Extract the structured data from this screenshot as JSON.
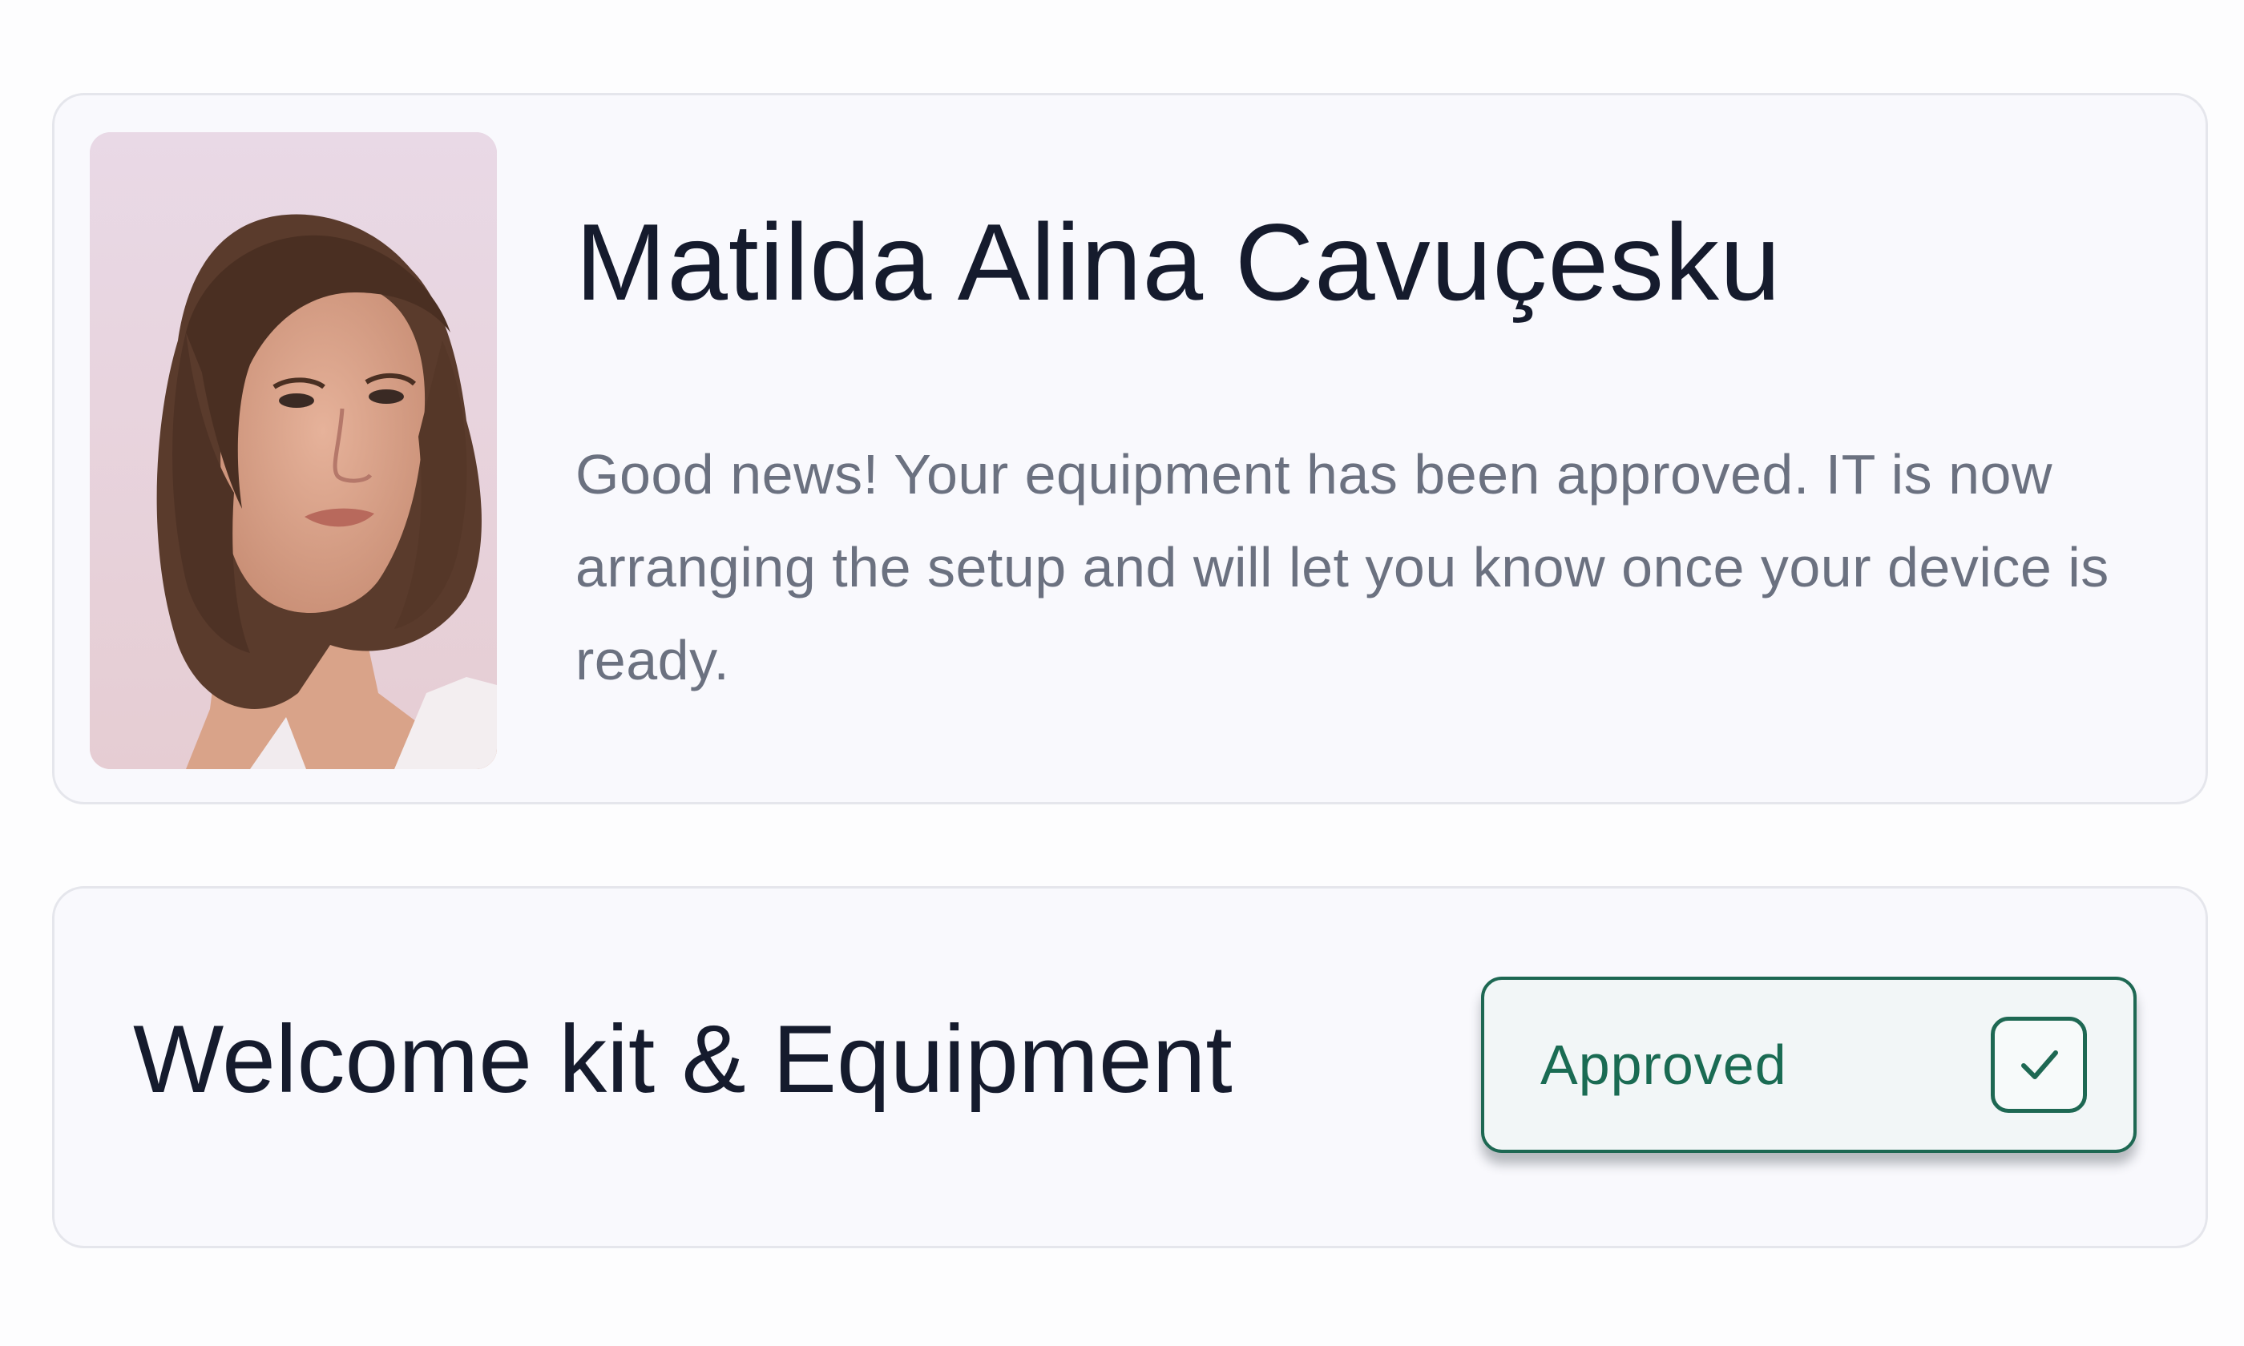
{
  "profile": {
    "name": "Matilda Alina Cavuçesku",
    "message": "Good news! Your equipment has been approved. IT is now arranging the setup and will let you know once your device is ready."
  },
  "task": {
    "title": "Welcome kit & Equipment",
    "status": "Approved",
    "status_icon": "check-icon"
  },
  "colors": {
    "status_accent": "#1e6853",
    "title_text": "#151b2d",
    "body_text": "#6b7180",
    "card_background": "#f9f9fd"
  }
}
